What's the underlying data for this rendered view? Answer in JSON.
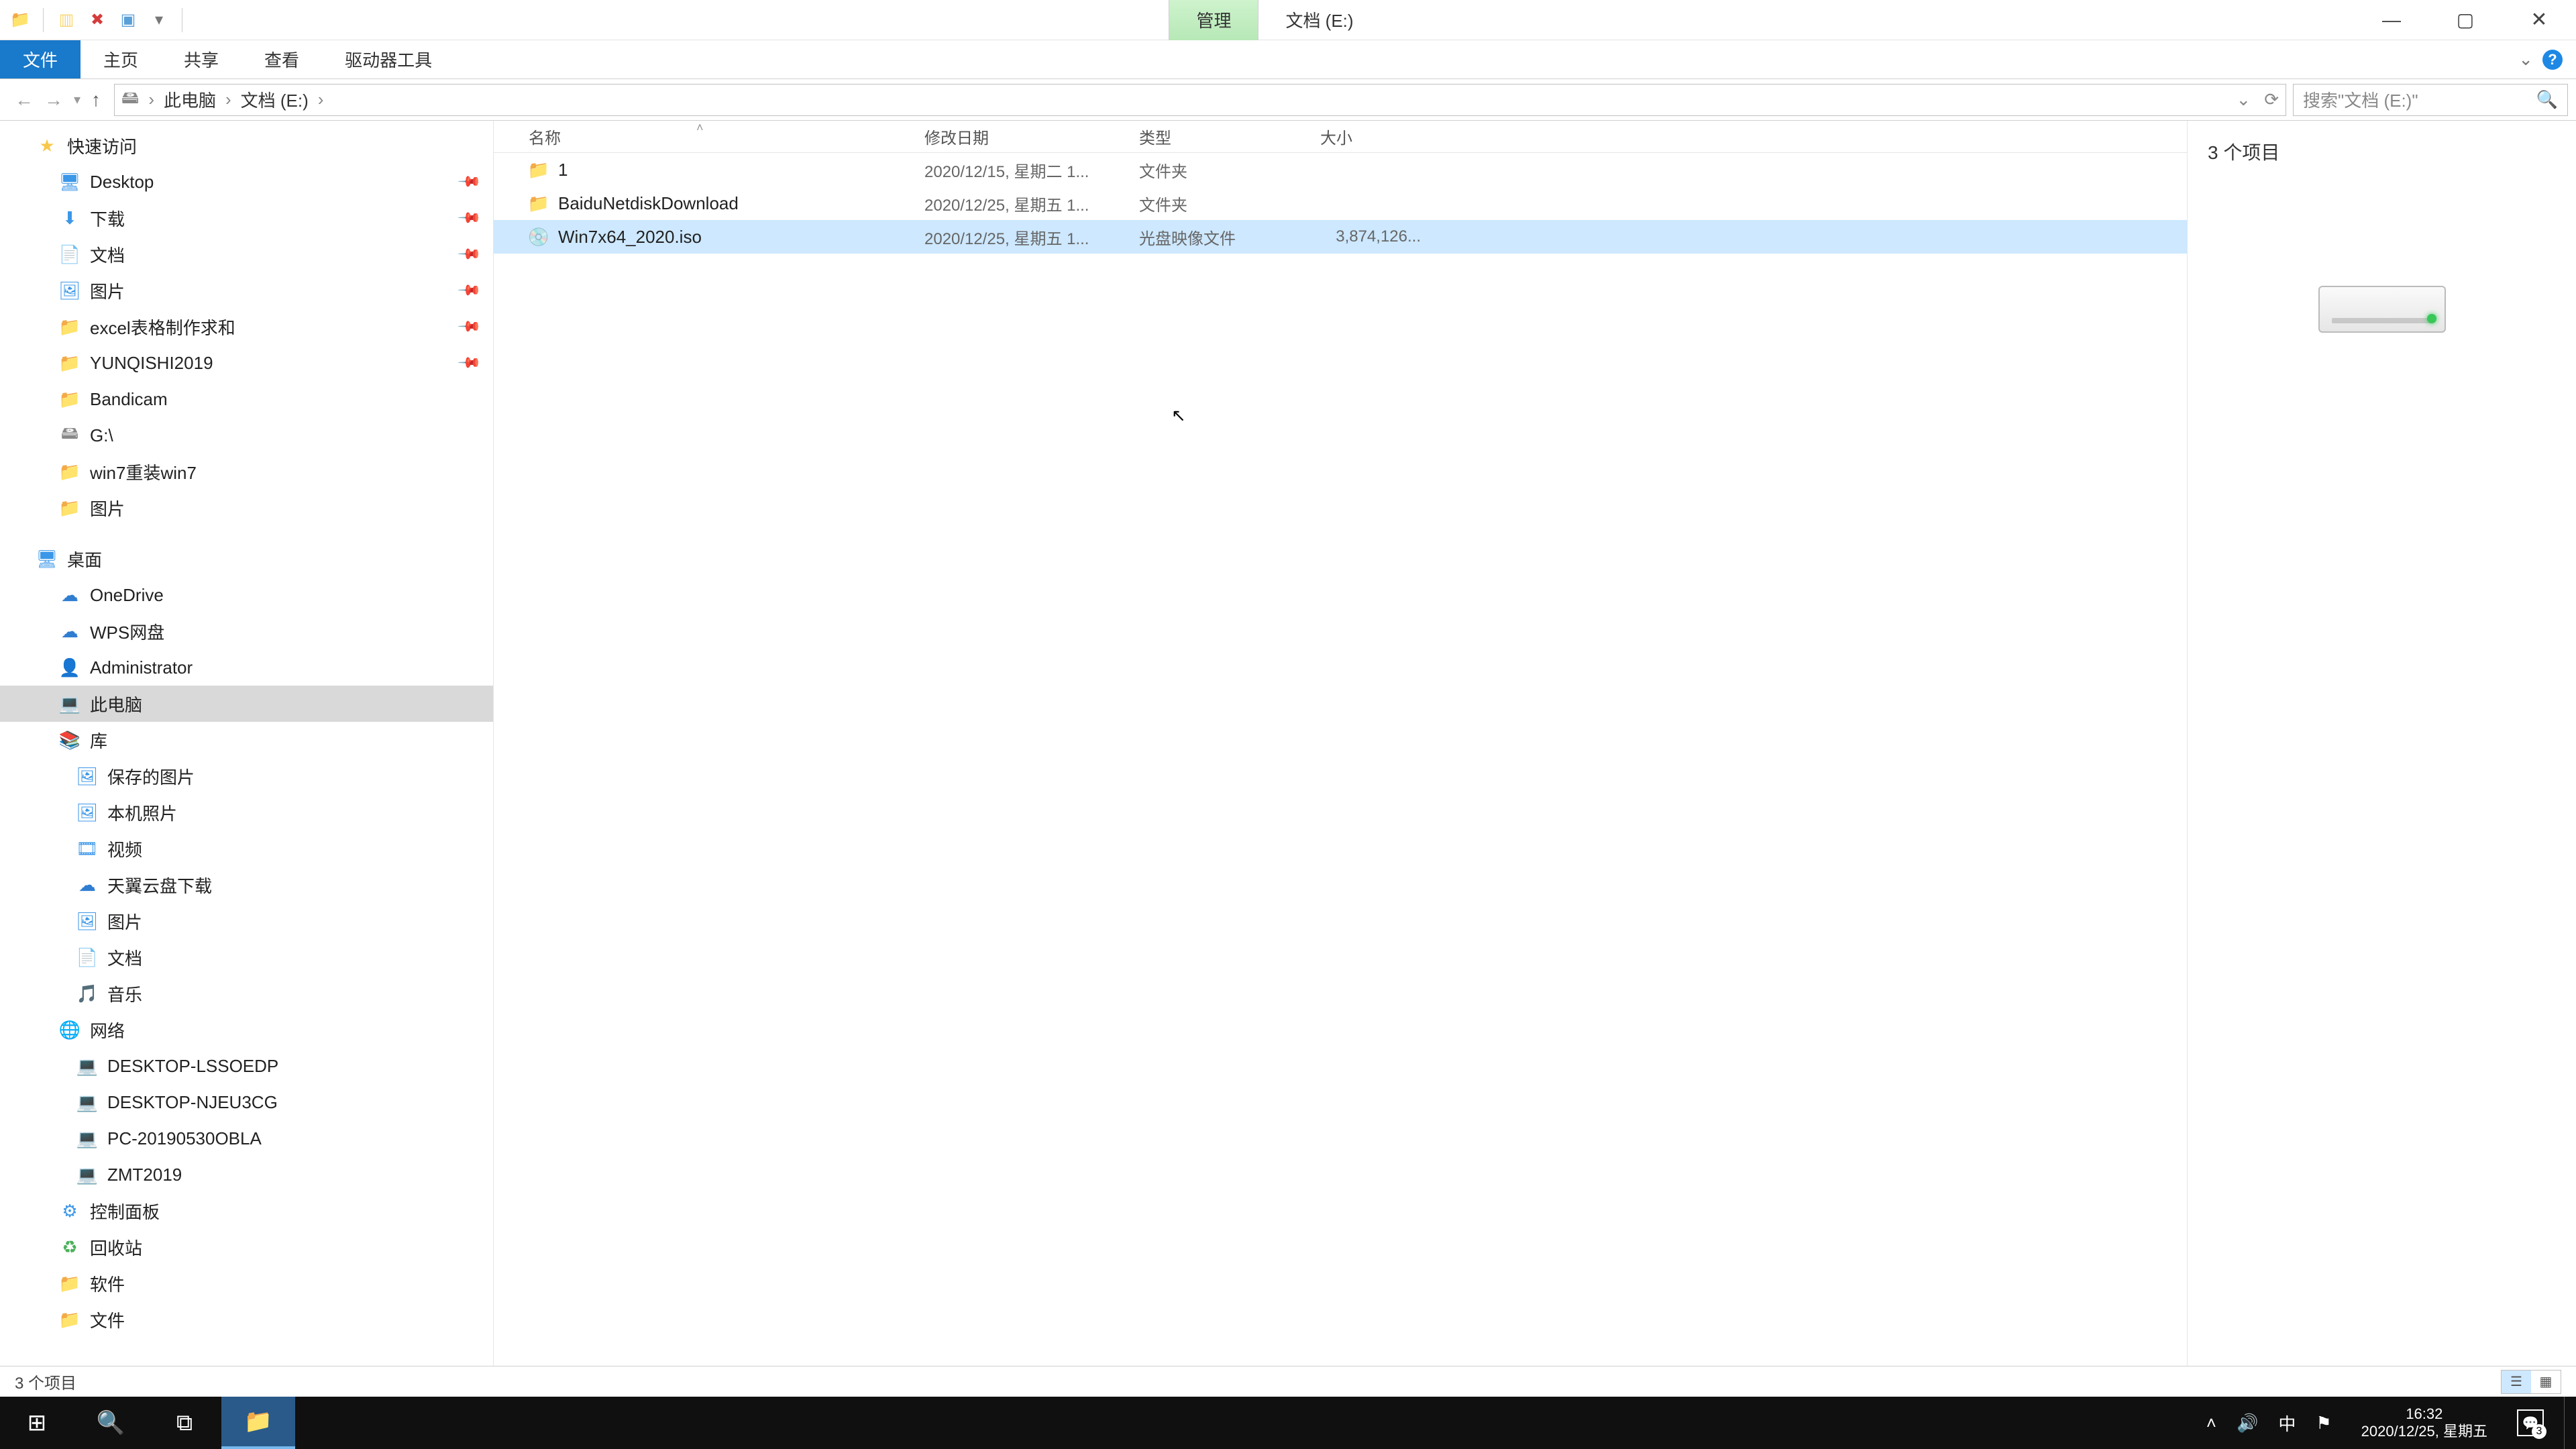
{
  "titlebar": {
    "manage_tab": "管理",
    "title_text": "文档 (E:)"
  },
  "ribbon": {
    "file": "文件",
    "home": "主页",
    "share": "共享",
    "view": "查看",
    "drive_tools": "驱动器工具"
  },
  "breadcrumbs": {
    "this_pc": "此电脑",
    "drive": "文档 (E:)"
  },
  "search": {
    "placeholder": "搜索\"文档 (E:)\""
  },
  "columns": {
    "name": "名称",
    "date": "修改日期",
    "type": "类型",
    "size": "大小"
  },
  "rows": [
    {
      "name": "1",
      "date": "2020/12/15, 星期二 1...",
      "type": "文件夹",
      "size": "",
      "icon": "folder",
      "selected": false
    },
    {
      "name": "BaiduNetdiskDownload",
      "date": "2020/12/25, 星期五 1...",
      "type": "文件夹",
      "size": "",
      "icon": "folder",
      "selected": false
    },
    {
      "name": "Win7x64_2020.iso",
      "date": "2020/12/25, 星期五 1...",
      "type": "光盘映像文件",
      "size": "3,874,126...",
      "icon": "iso",
      "selected": true
    }
  ],
  "preview": {
    "count_label": "3 个项目"
  },
  "statusbar": {
    "text": "3 个项目"
  },
  "sidebar": {
    "quick_access": "快速访问",
    "items_qa": [
      {
        "label": "Desktop",
        "icon": "desktop",
        "pin": true
      },
      {
        "label": "下载",
        "icon": "download",
        "pin": true
      },
      {
        "label": "文档",
        "icon": "doc",
        "pin": true
      },
      {
        "label": "图片",
        "icon": "pic",
        "pin": true
      },
      {
        "label": "excel表格制作求和",
        "icon": "folder",
        "pin": true
      },
      {
        "label": "YUNQISHI2019",
        "icon": "folder",
        "pin": true
      },
      {
        "label": "Bandicam",
        "icon": "folder",
        "pin": false
      },
      {
        "label": "G:\\",
        "icon": "drive",
        "pin": false
      },
      {
        "label": "win7重装win7",
        "icon": "folder",
        "pin": false
      },
      {
        "label": "图片",
        "icon": "folder",
        "pin": false
      }
    ],
    "desktop": "桌面",
    "items_desktop": [
      {
        "label": "OneDrive",
        "icon": "cloud"
      },
      {
        "label": "WPS网盘",
        "icon": "cloud"
      },
      {
        "label": "Administrator",
        "icon": "user"
      },
      {
        "label": "此电脑",
        "icon": "pc",
        "selected": true
      },
      {
        "label": "库",
        "icon": "lib"
      },
      {
        "label": "保存的图片",
        "icon": "pic2"
      },
      {
        "label": "本机照片",
        "icon": "pic2"
      },
      {
        "label": "视频",
        "icon": "video"
      },
      {
        "label": "天翼云盘下载",
        "icon": "cloud2"
      },
      {
        "label": "图片",
        "icon": "pic2"
      },
      {
        "label": "文档",
        "icon": "doc2"
      },
      {
        "label": "音乐",
        "icon": "music"
      },
      {
        "label": "网络",
        "icon": "net"
      },
      {
        "label": "DESKTOP-LSSOEDP",
        "icon": "netpc"
      },
      {
        "label": "DESKTOP-NJEU3CG",
        "icon": "netpc"
      },
      {
        "label": "PC-20190530OBLA",
        "icon": "netpc"
      },
      {
        "label": "ZMT2019",
        "icon": "netpc"
      },
      {
        "label": "控制面板",
        "icon": "cp"
      },
      {
        "label": "回收站",
        "icon": "recycle"
      },
      {
        "label": "软件",
        "icon": "folder"
      },
      {
        "label": "文件",
        "icon": "folder"
      }
    ]
  },
  "taskbar": {
    "time": "16:32",
    "date": "2020/12/25, 星期五",
    "ime": "中",
    "notif_count": "3"
  }
}
